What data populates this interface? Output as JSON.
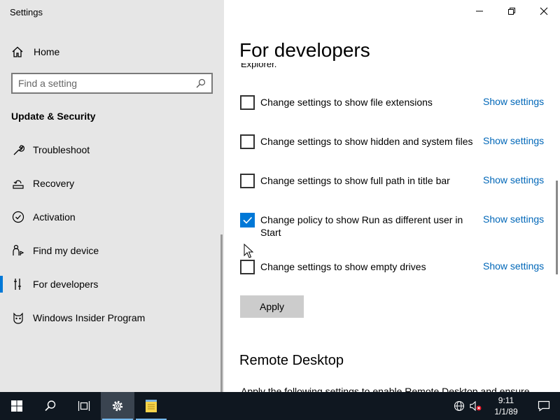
{
  "window": {
    "title": "Settings"
  },
  "sidebar": {
    "home_label": "Home",
    "search_placeholder": "Find a setting",
    "section_title": "Update & Security",
    "items": [
      {
        "label": "Troubleshoot",
        "icon": "wrench-icon"
      },
      {
        "label": "Recovery",
        "icon": "recovery-icon"
      },
      {
        "label": "Activation",
        "icon": "check-circle-icon"
      },
      {
        "label": "Find my device",
        "icon": "person-pin-icon"
      },
      {
        "label": "For developers",
        "icon": "developer-tools-icon",
        "active": true
      },
      {
        "label": "Windows Insider Program",
        "icon": "insider-cat-icon"
      }
    ]
  },
  "main": {
    "title": "For developers",
    "clipped_text": "Explorer.",
    "settings": [
      {
        "label": "Change settings to show file extensions",
        "checked": false,
        "link": "Show settings"
      },
      {
        "label": "Change settings to show hidden and system files",
        "checked": false,
        "link": "Show settings"
      },
      {
        "label": "Change settings to show full path in title bar",
        "checked": false,
        "link": "Show settings"
      },
      {
        "label": "Change policy to show Run as different user in Start",
        "checked": true,
        "link": "Show settings"
      },
      {
        "label": "Change settings to show empty drives",
        "checked": false,
        "link": "Show settings"
      }
    ],
    "apply_label": "Apply",
    "remote_desktop_title": "Remote Desktop",
    "remote_desktop_text": "Apply the following settings to enable Remote Desktop and ensure"
  },
  "taskbar": {
    "time": "9:11",
    "date": "1/1/89"
  },
  "colors": {
    "accent": "#0078d7",
    "link": "#0067b8",
    "sidebar_bg": "#e6e6e6",
    "taskbar_bg": "#0f1720"
  }
}
